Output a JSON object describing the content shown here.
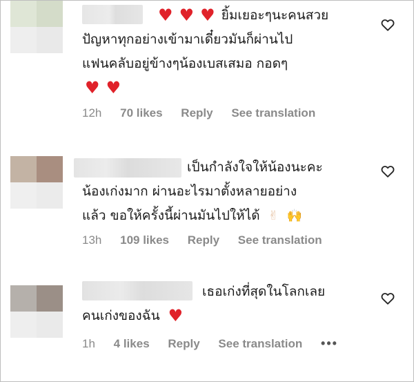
{
  "comments": [
    {
      "lines": [
        "ยิ้มเยอะๆนะคนสวย",
        "ปัญหาทุกอย่างเข้ามาเดี๋ยวมันก็ผ่านไป",
        "แฟนคลับอยู่ข้างๆน้องเบสเสมอ กอดๆ"
      ],
      "time": "12h",
      "likes": "70 likes",
      "reply": "Reply",
      "translate": "See translation",
      "like_icon": "heart-outline-icon"
    },
    {
      "lines": [
        "เป็นกำลังใจให้น้องนะคะ",
        "น้องเก่งมาก ผ่านอะไรมาตั้งหลายอย่าง",
        "แล้ว ขอให้ครั้งนี้ผ่านมันไปให้ได้"
      ],
      "time": "13h",
      "likes": "109 likes",
      "reply": "Reply",
      "translate": "See translation",
      "like_icon": "heart-outline-icon"
    },
    {
      "lines": [
        "เธอเก่งที่สุดในโลกเลย",
        "คนเก่งของฉัน"
      ],
      "time": "1h",
      "likes": "4 likes",
      "reply": "Reply",
      "translate": "See translation",
      "more": "•••",
      "like_icon": "heart-outline-icon"
    }
  ],
  "colors": {
    "heart": "#e0222a",
    "meta_text": "#8a8a8a",
    "body_text": "#1a1a1a"
  }
}
